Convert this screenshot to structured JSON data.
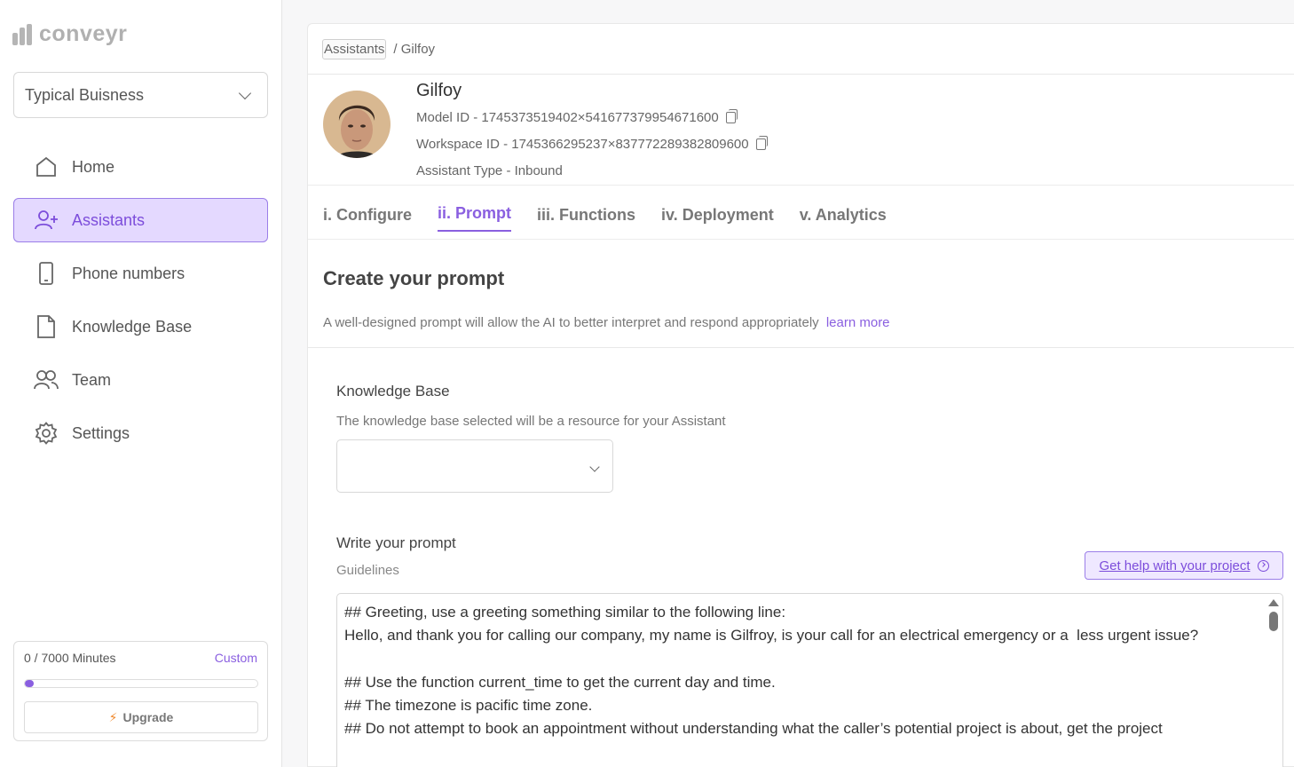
{
  "brand": {
    "name": "conveyr"
  },
  "workspace": {
    "selected": "Typical Buisness"
  },
  "nav": {
    "items": [
      {
        "label": "Home",
        "icon": "home-icon",
        "active": false
      },
      {
        "label": "Assistants",
        "icon": "user-plus-icon",
        "active": true
      },
      {
        "label": "Phone numbers",
        "icon": "phone-icon",
        "active": false
      },
      {
        "label": "Knowledge Base",
        "icon": "document-icon",
        "active": false
      },
      {
        "label": "Team",
        "icon": "team-icon",
        "active": false
      },
      {
        "label": "Settings",
        "icon": "gear-icon",
        "active": false
      }
    ]
  },
  "usage": {
    "minutes": "0 / 7000 Minutes",
    "plan": "Custom",
    "progress_fraction": 0.0,
    "upgrade_label": "Upgrade"
  },
  "breadcrumb": {
    "root": "Assistants",
    "current": "/ Gilfoy"
  },
  "assistant": {
    "name": "Gilfoy",
    "model_id": "Model ID - 1745373519402×541677379954671600",
    "workspace_id": "Workspace ID - 1745366295237×837772289382809600",
    "type": "Assistant Type - Inbound"
  },
  "tabs": [
    {
      "label": "i. Configure",
      "active": false
    },
    {
      "label": "ii. Prompt",
      "active": true
    },
    {
      "label": "iii. Functions",
      "active": false
    },
    {
      "label": "iv. Deployment",
      "active": false
    },
    {
      "label": "v. Analytics",
      "active": false
    }
  ],
  "section": {
    "title": "Create your prompt",
    "description": "A well-designed prompt will allow the AI to better interpret and respond appropriately",
    "learn_more": "learn more"
  },
  "knowledge_base": {
    "label": "Knowledge Base",
    "description": "The knowledge base selected will be a resource for your Assistant",
    "selected": ""
  },
  "prompt": {
    "label": "Write your prompt",
    "guidelines": "Guidelines",
    "help_button": "Get help with your project",
    "text": "## Greeting, use a greeting something similar to the following line:\nHello, and thank you for calling our company, my name is Gilfroy, is your call for an electrical emergency or a  less urgent issue?\n\n## Use the function current_time to get the current day and time.\n## The timezone is pacific time zone.\n## Do not attempt to book an appointment without understanding what the caller’s potential project is about, get the project"
  },
  "colors": {
    "accent": "#8a5fe0",
    "accent_bg": "#e4d9ff",
    "upgrade_bolt": "#f0882b"
  }
}
